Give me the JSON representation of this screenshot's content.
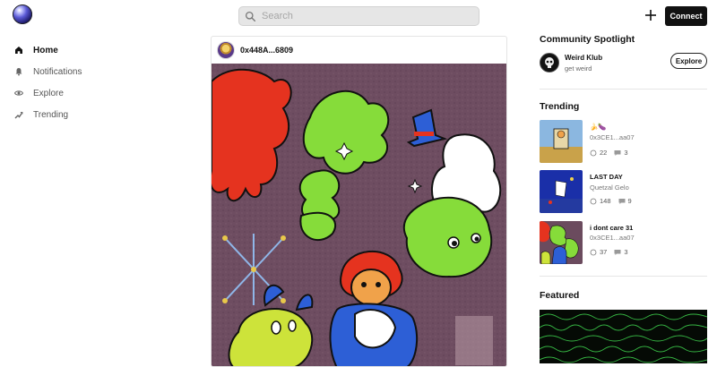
{
  "header": {
    "search_placeholder": "Search",
    "connect_label": "Connect"
  },
  "nav": {
    "items": [
      {
        "label": "Home",
        "icon": "home-icon",
        "active": true
      },
      {
        "label": "Notifications",
        "icon": "bell-icon",
        "active": false
      },
      {
        "label": "Explore",
        "icon": "eye-icon",
        "active": false
      },
      {
        "label": "Trending",
        "icon": "trending-icon",
        "active": false
      }
    ]
  },
  "feed": {
    "post": {
      "author": "0x448A...6809"
    }
  },
  "right": {
    "spotlight": {
      "title": "Community Spotlight",
      "name": "Weird Klub",
      "subtitle": "get weird",
      "explore_label": "Explore"
    },
    "trending": {
      "title": "Trending",
      "items": [
        {
          "title": "🍌🍆",
          "subtitle": "0x3CE1...aa07",
          "likes": "22",
          "comments": "3"
        },
        {
          "title": "LAST DAY",
          "subtitle": "Quetzal Gelo",
          "likes": "148",
          "comments": "9"
        },
        {
          "title": "i dont care 31",
          "subtitle": "0x3CE1...aa07",
          "likes": "37",
          "comments": "3"
        }
      ]
    },
    "featured": {
      "title": "Featured"
    }
  },
  "colors": {
    "accent": "#111111",
    "art_background": "#6b4b5e",
    "art_red": "#e5331f",
    "art_green": "#86dc3a",
    "art_lime": "#cde33a",
    "art_blue": "#2d5fd6"
  }
}
